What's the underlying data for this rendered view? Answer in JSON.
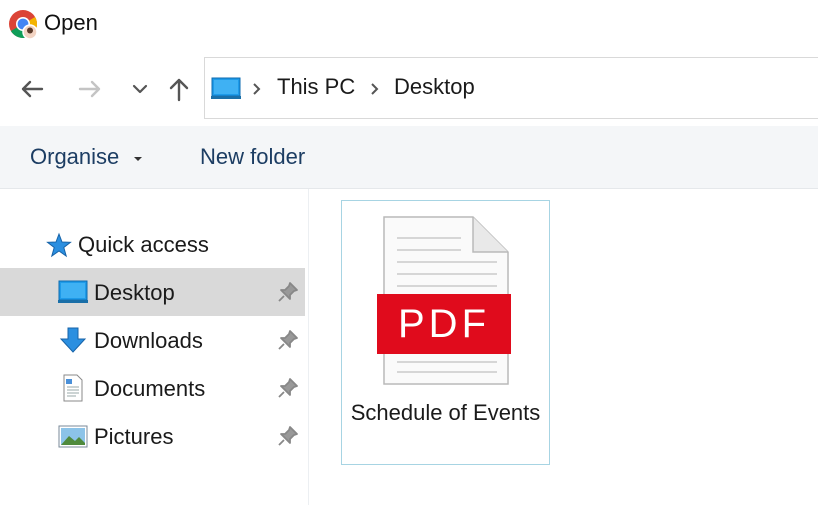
{
  "window": {
    "title": "Open"
  },
  "nav": {
    "breadcrumb": [
      "This PC",
      "Desktop"
    ]
  },
  "toolbar": {
    "organise_label": "Organise",
    "new_folder_label": "New folder"
  },
  "sidebar": {
    "quick_access_label": "Quick access",
    "items": [
      {
        "label": "Desktop",
        "icon": "desktop-icon",
        "selected": true
      },
      {
        "label": "Downloads",
        "icon": "download-icon",
        "selected": false
      },
      {
        "label": "Documents",
        "icon": "documents-icon",
        "selected": false
      },
      {
        "label": "Pictures",
        "icon": "pictures-icon",
        "selected": false
      }
    ]
  },
  "files": [
    {
      "name": "Schedule of Events",
      "badge": "PDF",
      "badge_color": "#e00b1c"
    }
  ]
}
